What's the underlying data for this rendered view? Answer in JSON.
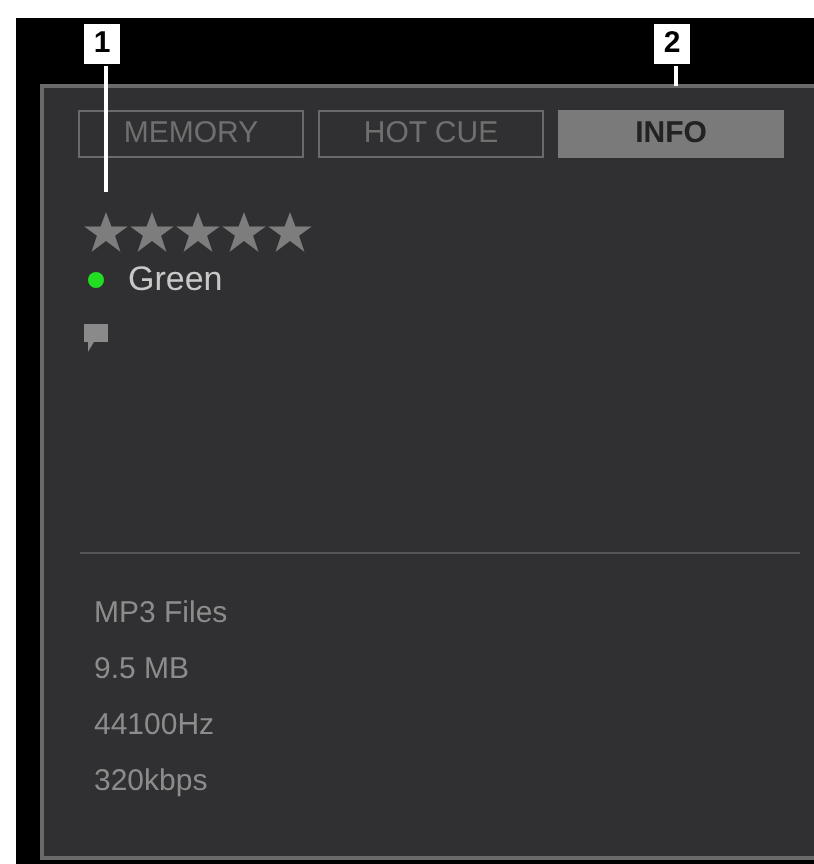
{
  "callouts": [
    "1",
    "2"
  ],
  "tabs": [
    {
      "label": "MEMORY",
      "selected": false
    },
    {
      "label": "HOT CUE",
      "selected": false
    },
    {
      "label": "INFO",
      "selected": true
    }
  ],
  "rating": {
    "stars": 0
  },
  "color_tag": {
    "label": "Green",
    "color": "#22dd22"
  },
  "info": [
    "MP3 Files",
    "9.5 MB",
    "44100Hz",
    "320kbps"
  ]
}
